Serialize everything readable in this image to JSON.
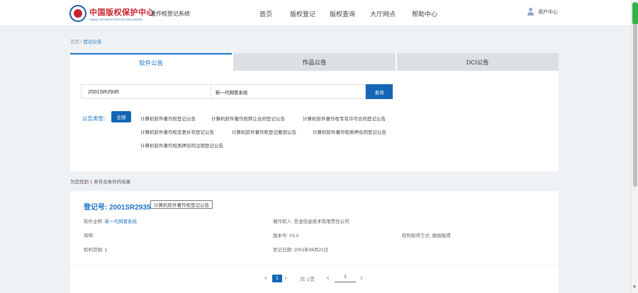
{
  "header": {
    "logo_cn": "中国版权保护中心",
    "logo_en": "CHINA COPYRIGHT PROTECTION CENTER",
    "system_name": "著作权登记系统",
    "nav": [
      "首页",
      "版权登记",
      "版权查询",
      "大厅网点",
      "帮助中心"
    ],
    "user_center": "用户中心"
  },
  "breadcrumb": {
    "home": "首页",
    "separator": "/",
    "current": "登记公告"
  },
  "tabs": [
    "软件公告",
    "作品公告",
    "DCI公告"
  ],
  "search": {
    "reg_no_value": "2001SR2935",
    "name_value": "新一代网管系统",
    "button": "查询"
  },
  "filters": {
    "label": "公告类型：",
    "all": "全部",
    "items": [
      "计算机软件著作权登记公告",
      "计算机软件著作权转让合同登记公告",
      "计算机软件著作权专有许可合同登记公告",
      "计算机软件著作权变更补充登记公告",
      "计算机软件著作权登记撤销公告",
      "计算机软件著作权质押合同登记公告",
      "计算机软件著作权质押合同注销登记公告"
    ]
  },
  "results": {
    "prefix": "为您找到",
    "count": "1",
    "suffix": "条符合条件的结果"
  },
  "record": {
    "title": "登记号: 2001SR2935",
    "tag": "计算机软件著作权登记公告",
    "full_name_label": "软件全称:",
    "full_name": "新一代网管系统",
    "owner_label": "著作权人:",
    "owner": "巨龙信息技术有限责任公司",
    "short_name_label": "简称:",
    "short_name": "",
    "version_label": "版本号:",
    "version": "V1.0",
    "method_label": "权利取得方式:",
    "method": "原始取得",
    "scope_label": "权利范围:",
    "scope": "1",
    "date_label": "登记日期:",
    "date": "2001年08月21日"
  },
  "pagination": {
    "current": "1",
    "total": "共 1页",
    "prev": "‹",
    "next": "›",
    "jump_value": "1"
  },
  "colors": {
    "primary": "#1566b5",
    "link": "#1a73c7",
    "brand_red": "#c8232c",
    "scrollbar_green": "#34b24a"
  }
}
